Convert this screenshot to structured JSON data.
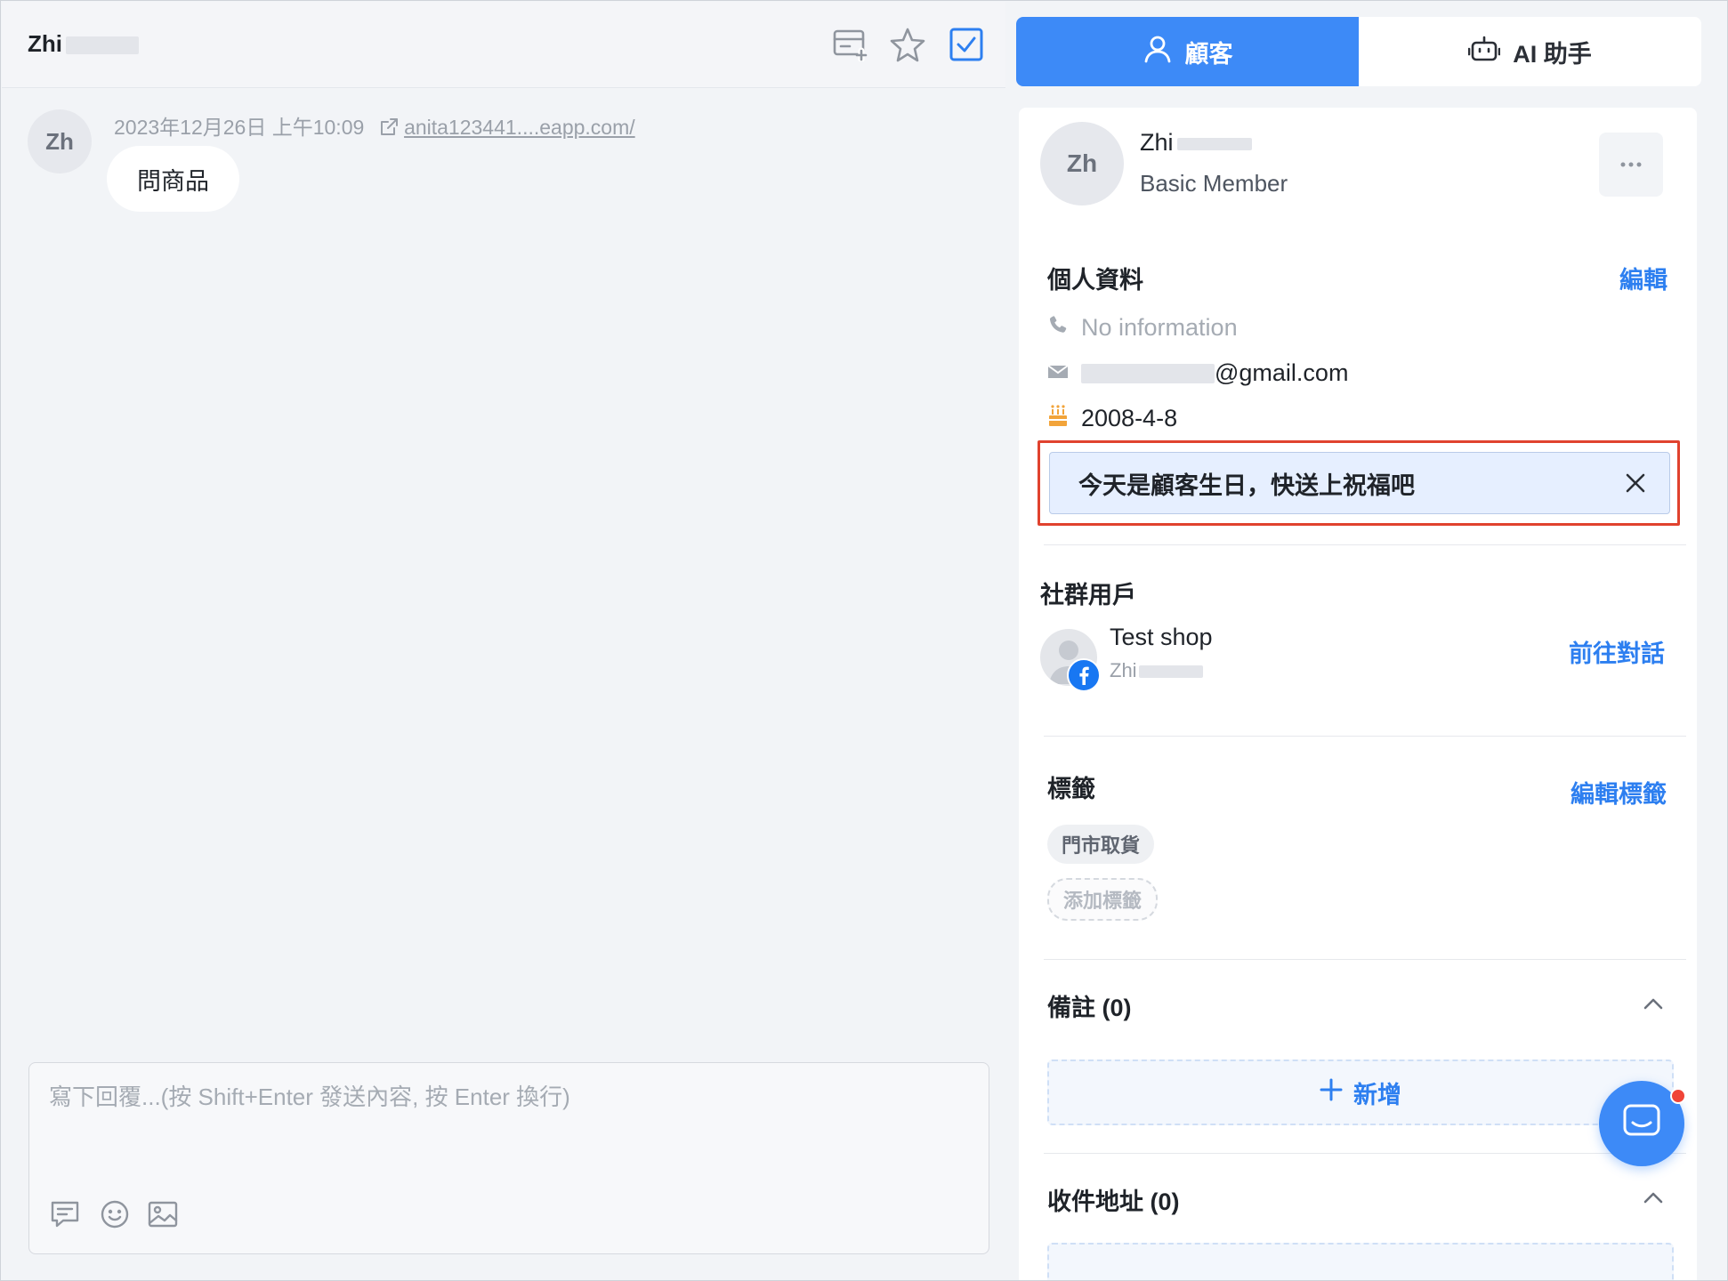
{
  "chat": {
    "title": "Zhi",
    "header_icons": [
      "archive-add-icon",
      "star-icon",
      "checkbox-icon"
    ],
    "avatar_initials": "Zh",
    "message": {
      "timestamp": "2023年12月26日 上午10:09",
      "link_text": "anita123441....eapp.com/",
      "text": "問商品"
    },
    "composer": {
      "placeholder": "寫下回覆...(按 Shift+Enter 發送內容, 按 Enter 換行)",
      "tools": [
        "quick-reply-icon",
        "emoji-icon",
        "image-icon"
      ]
    }
  },
  "tabs": [
    {
      "label": "顧客",
      "icon": "user-icon",
      "active": true
    },
    {
      "label": "AI 助手",
      "icon": "robot-icon",
      "active": false
    }
  ],
  "customer": {
    "avatar_initials": "Zh",
    "name": "Zhi",
    "tier": "Basic Member",
    "profile_section": {
      "title": "個人資料",
      "edit_label": "編輯",
      "phone": "No information",
      "email": "@gmail.com",
      "birthday": "2008-4-8"
    },
    "birthday_notice": "今天是顧客生日，快送上祝福吧",
    "social_section": {
      "title": "社群用戶",
      "shop_name": "Test shop",
      "user_name": "Zhi",
      "go_chat_label": "前往對話"
    },
    "tags_section": {
      "title": "標籤",
      "edit_label": "編輯標籤",
      "tags": [
        "門市取貨"
      ],
      "add_label": "添加標籤"
    },
    "notes_section": {
      "title": "備註 (0)",
      "add_label": "新增"
    },
    "address_section": {
      "title": "收件地址 (0)"
    }
  },
  "colors": {
    "accent": "#3d8af7",
    "link": "#2d7ff0",
    "notice_border": "#e0422e",
    "notice_bg": "#e6efff"
  }
}
